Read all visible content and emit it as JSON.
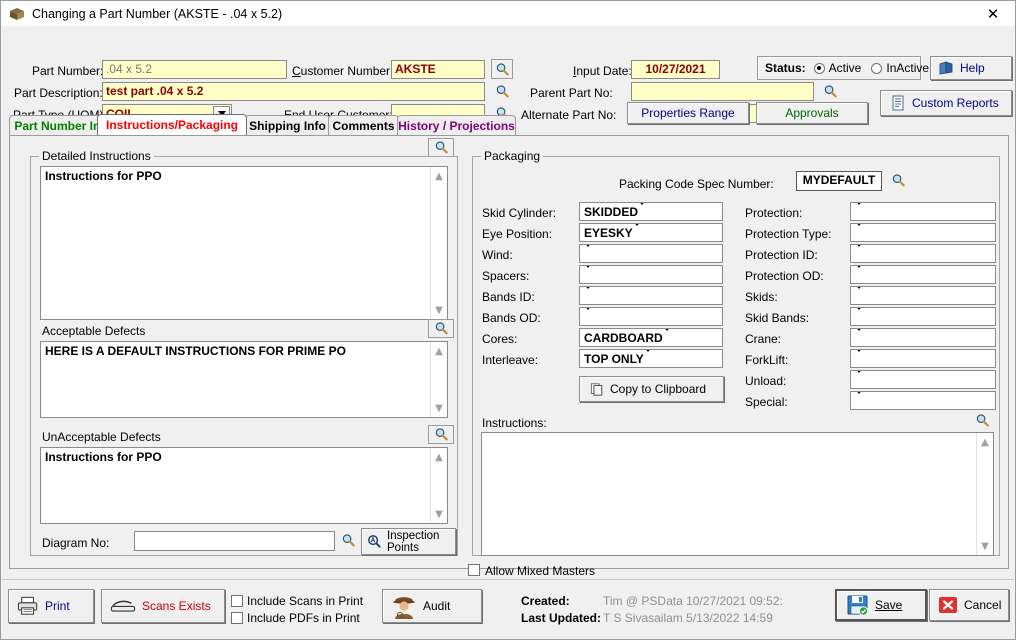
{
  "window": {
    "title": "Changing a Part Number  (AKSTE - .04 x 5.2)",
    "close_label": "✕",
    "icon": "app-icon"
  },
  "header": {
    "fields": [
      {
        "label": "Part Number:",
        "value": ".04 x 5.2",
        "accel": ""
      },
      {
        "label": "Customer Number:",
        "value": "AKSTE",
        "accel": "C"
      },
      {
        "label": "Part Description:",
        "value": "test part .04 x 5.2",
        "accel": ""
      },
      {
        "label": "Part Type (UOM):",
        "value": "COIL",
        "accel": ""
      },
      {
        "label": "End User Customer:",
        "value": "",
        "accel": ""
      },
      {
        "label": "Input Date:",
        "value": "10/27/2021",
        "accel": "I"
      },
      {
        "label": "Parent Part No:",
        "value": "",
        "accel": ""
      },
      {
        "label": "Alternate Part No:",
        "value": "",
        "accel": ""
      }
    ],
    "status": {
      "label": "Status:",
      "options": [
        "Active",
        "InActive"
      ],
      "selected": "Active"
    },
    "help_label": "Help",
    "custom_reports_label": "Custom Reports",
    "properties_range_label": "Properties Range",
    "approvals_label": "Approvals"
  },
  "tabs": [
    {
      "label": "Part Number Info",
      "color": "green",
      "active": false
    },
    {
      "label": "Instructions/Packaging",
      "color": "red",
      "active": true
    },
    {
      "label": "Shipping Info",
      "color": "black",
      "active": false
    },
    {
      "label": "Comments",
      "color": "black",
      "active": false
    },
    {
      "label": "History / Projections",
      "color": "purple",
      "active": false
    }
  ],
  "left_panel": {
    "group_title": "Detailed Instructions",
    "detailed_instructions_text": "Instructions for PPO",
    "acceptable_defects_label": "Acceptable Defects",
    "acceptable_defects_text": "HERE IS A DEFAULT INSTRUCTIONS FOR PRIME PO",
    "unacceptable_defects_label": "UnAcceptable Defects",
    "unacceptable_defects_text": "Instructions for PPO",
    "diagram_label": "Diagram No:",
    "diagram_value": "",
    "inspection_points_label_line1": "Inspection",
    "inspection_points_label_line2": "Points"
  },
  "packaging": {
    "group_title": "Packaging",
    "spec_label": "Packing Code Spec Number:",
    "spec_value": "MYDEFAULT",
    "left_fields": [
      {
        "label": "Skid Cylinder:",
        "value": "SKIDDED"
      },
      {
        "label": "Eye Position:",
        "value": "EYESKY"
      },
      {
        "label": "Wind:",
        "value": ""
      },
      {
        "label": "Spacers:",
        "value": ""
      },
      {
        "label": "Bands ID:",
        "value": ""
      },
      {
        "label": "Bands OD:",
        "value": ""
      },
      {
        "label": "Cores:",
        "value": "CARDBOARD"
      },
      {
        "label": "Interleave:",
        "value": "TOP ONLY"
      }
    ],
    "right_fields": [
      {
        "label": "Protection:",
        "value": ""
      },
      {
        "label": "Protection Type:",
        "value": ""
      },
      {
        "label": "Protection ID:",
        "value": ""
      },
      {
        "label": "Protection OD:",
        "value": ""
      },
      {
        "label": "Skids:",
        "value": ""
      },
      {
        "label": "Skid Bands:",
        "value": ""
      },
      {
        "label": "Crane:",
        "value": ""
      },
      {
        "label": "ForkLift:",
        "value": ""
      },
      {
        "label": "Unload:",
        "value": ""
      },
      {
        "label": "Special:",
        "value": ""
      }
    ],
    "copy_to_clipboard_label": "Copy to Clipboard",
    "instructions_label": "Instructions:",
    "instructions_text": "",
    "allow_mixed_masters_label": "Allow Mixed Masters",
    "allow_mixed_masters_checked": false
  },
  "footer": {
    "print_label": "Print",
    "scans_label": "Scans Exists",
    "include_scans_label": "Include Scans in Print",
    "include_pdfs_label": "Include PDFs in Print",
    "include_scans_checked": false,
    "include_pdfs_checked": false,
    "audit_label": "Audit",
    "created_label": "Created:",
    "created_value": "Tim @ PSData 10/27/2021 09:52:",
    "last_updated_label": "Last Updated:",
    "last_updated_value": "T S Sivasailam 5/13/2022 14:59",
    "save_label": "Save",
    "cancel_label": "Cancel"
  },
  "colors": {
    "field_bg": "#ffffc8",
    "value_red": "#8b0000",
    "tab_active_red": "#ff0000",
    "tab_green": "#008000",
    "tab_purple": "#800080",
    "link_blue": "#00008b",
    "approvals_green": "#006400",
    "scans_red": "#cc0000",
    "cancel_red": "#e03030"
  }
}
